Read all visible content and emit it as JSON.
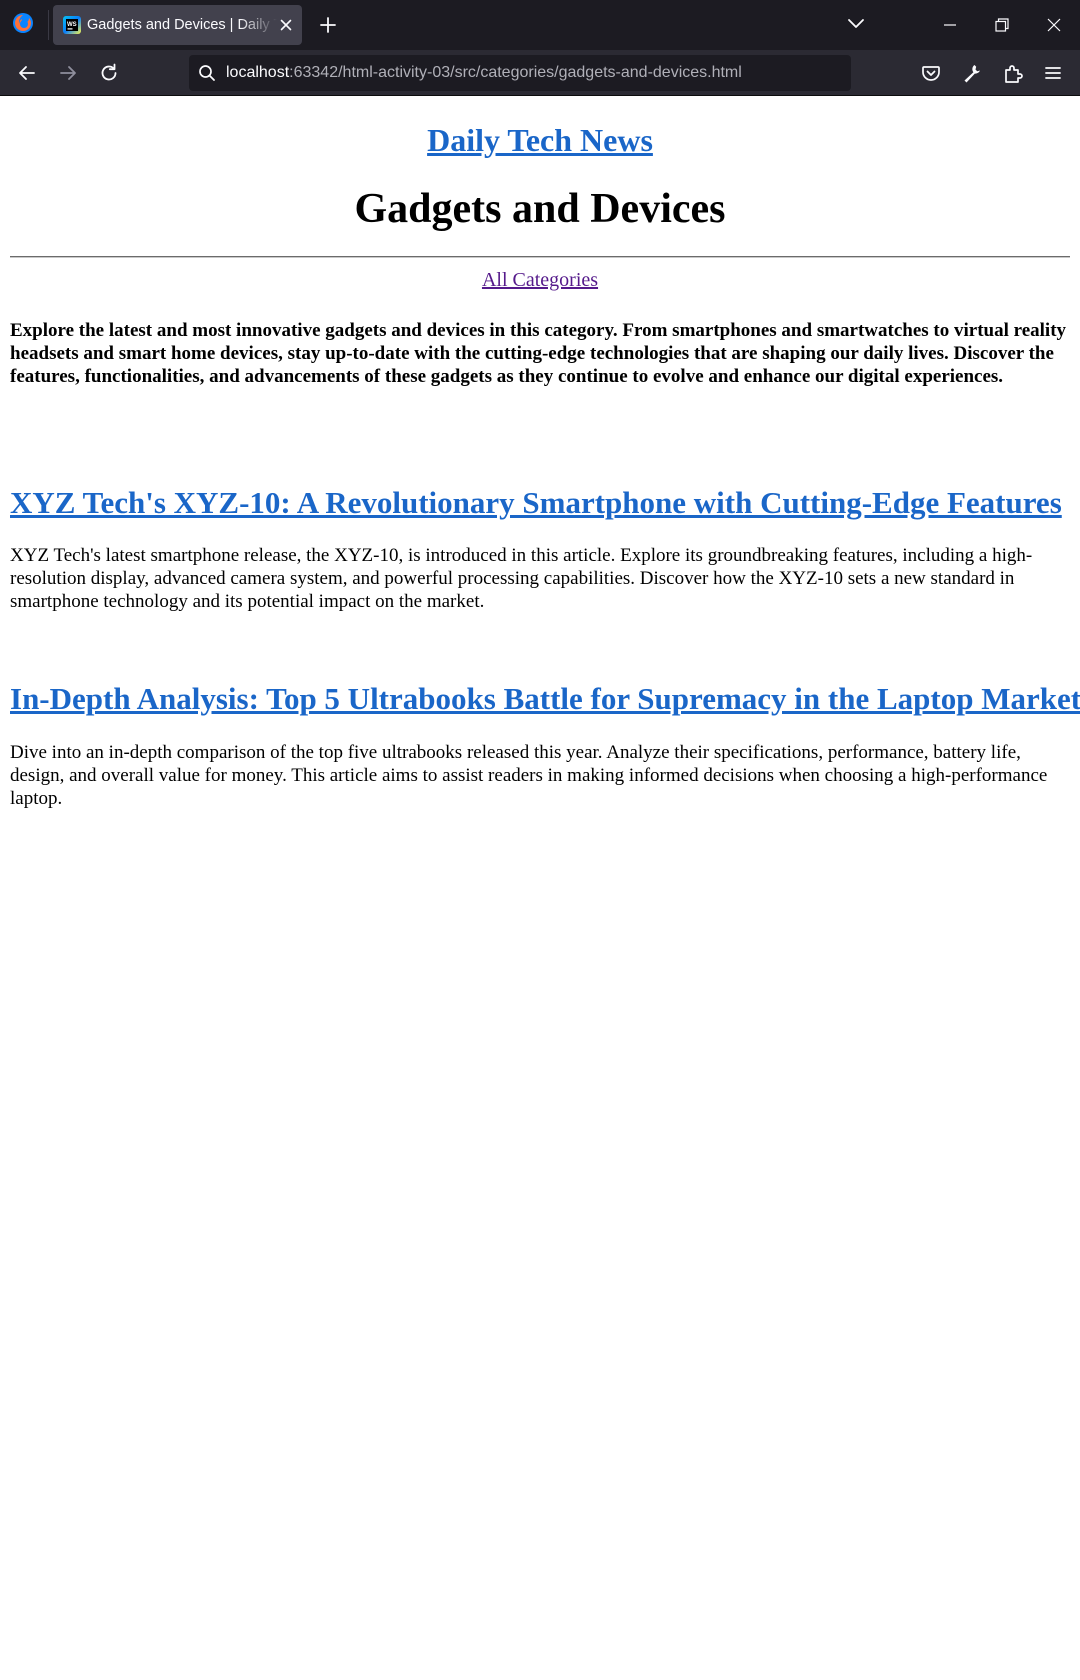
{
  "browser": {
    "tab": {
      "title": "Gadgets and Devices | Daily Tech News"
    },
    "url": {
      "host": "localhost",
      "rest": ":63342/html-activity-03/src/categories/gadgets-and-devices.html"
    },
    "icons": {
      "app": "firefox-logo-icon",
      "favicon": "webstorm-favicon-icon",
      "tab_close": "close-icon",
      "new_tab": "plus-icon",
      "tab_list": "chevron-down-icon",
      "minimize": "minimize-icon",
      "restore": "restore-icon",
      "close_window": "close-icon",
      "back": "arrow-left-icon",
      "forward": "arrow-right-icon",
      "reload": "reload-icon",
      "search": "search-icon",
      "pocket": "pocket-icon",
      "tools": "wrench-icon",
      "extensions": "puzzle-icon",
      "menu": "hamburger-menu-icon"
    }
  },
  "page": {
    "site_title": "Daily Tech News",
    "category_title": "Gadgets and Devices",
    "all_categories_link": "All Categories",
    "intro": "Explore the latest and most innovative gadgets and devices in this category. From smartphones and smartwatches to virtual reality headsets and smart home devices, stay up-to-date with the cutting-edge technologies that are shaping our daily lives. Discover the features, functionalities, and advancements of these gadgets as they continue to evolve and enhance our digital experiences.",
    "articles": [
      {
        "title": "XYZ Tech's XYZ-10: A Revolutionary Smartphone with Cutting-Edge Features",
        "summary": "XYZ Tech's latest smartphone release, the XYZ-10, is introduced in this article. Explore its groundbreaking features, including a high-resolution display, advanced camera system, and powerful processing capabilities. Discover how the XYZ-10 sets a new standard in smartphone technology and its potential impact on the market."
      },
      {
        "title": "In-Depth Analysis: Top 5 Ultrabooks Battle for Supremacy in the Laptop Market",
        "summary": "Dive into an in-depth comparison of the top five ultrabooks released this year. Analyze their specifications, performance, battery life, design, and overall value for money. This article aims to assist readers in making informed decisions when choosing a high-performance laptop."
      }
    ],
    "colors": {
      "link": "#1a66c8",
      "visited_link": "#551a8b",
      "chrome_bg": "#1c1b22",
      "toolbar_bg": "#2b2a33"
    }
  }
}
